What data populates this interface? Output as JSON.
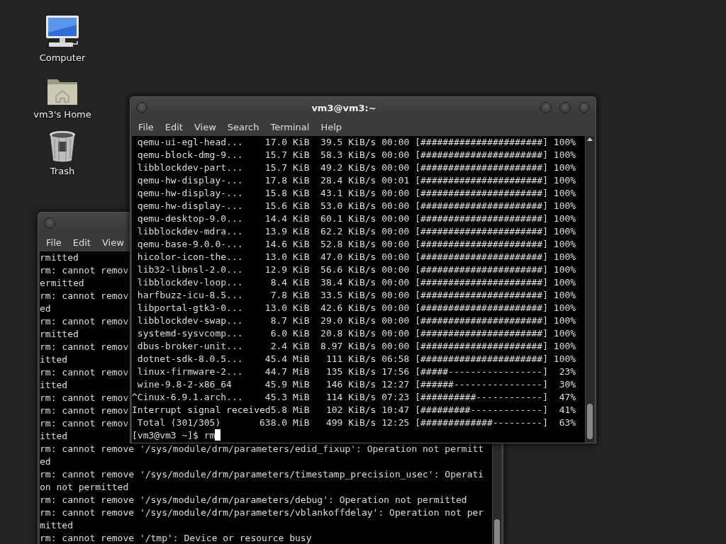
{
  "desktop_icons": [
    {
      "label": "Computer",
      "kind": "computer"
    },
    {
      "label": "vm3's Home",
      "kind": "home"
    },
    {
      "label": "Trash",
      "kind": "trash"
    }
  ],
  "windows": [
    {
      "kind": "back",
      "menu": [
        "File",
        "Edit",
        "View"
      ],
      "lines": [
        "rmitted",
        "rm: cannot remov",
        "ermitted",
        "rm: cannot remov",
        "ed",
        "rm: cannot remov",
        "rmitted",
        "rm: cannot remov",
        "itted",
        "rm: cannot remov",
        "itted",
        "rm: cannot remov",
        "rm: cannot remov",
        "rm: cannot remov",
        "itted",
        "rm: cannot remove '/sys/module/drm/parameters/edid_fixup': Operation not permitt",
        "ed",
        "rm: cannot remove '/sys/module/drm/parameters/timestamp_precision_usec': Operati",
        "on not permitted",
        "rm: cannot remove '/sys/module/drm/parameters/debug': Operation not permitted",
        "rm: cannot remove '/sys/module/drm/parameters/vblankoffdelay': Operation not per",
        "mitted",
        "rm: cannot remove '/tmp': Device or resource busy"
      ]
    },
    {
      "kind": "front",
      "title": "vm3@vm3:~",
      "menu": [
        "File",
        "Edit",
        "View",
        "Search",
        "Terminal",
        "Help"
      ],
      "lines": [
        " qemu-ui-egl-head...    17.0 KiB  39.5 KiB/s 00:00 [######################] 100%",
        " qemu-block-dmg-9...    15.7 KiB  58.3 KiB/s 00:00 [######################] 100%",
        " libblockdev-part...    15.7 KiB  49.2 KiB/s 00:00 [######################] 100%",
        " qemu-hw-display-...    17.8 KiB  28.4 KiB/s 00:01 [######################] 100%",
        " qemu-hw-display-...    15.8 KiB  43.1 KiB/s 00:00 [######################] 100%",
        " qemu-hw-display-...    15.6 KiB  53.0 KiB/s 00:00 [######################] 100%",
        " qemu-desktop-9.0...    14.4 KiB  60.1 KiB/s 00:00 [######################] 100%",
        " libblockdev-mdra...    13.9 KiB  62.2 KiB/s 00:00 [######################] 100%",
        " qemu-base-9.0.0-...    14.6 KiB  52.8 KiB/s 00:00 [######################] 100%",
        " hicolor-icon-the...    13.0 KiB  47.0 KiB/s 00:00 [######################] 100%",
        " lib32-libnsl-2.0...    12.9 KiB  56.6 KiB/s 00:00 [######################] 100%",
        " libblockdev-loop...     8.4 KiB  38.4 KiB/s 00:00 [######################] 100%",
        " harfbuzz-icu-8.5...     7.8 KiB  33.5 KiB/s 00:00 [######################] 100%",
        " libportal-gtk3-0...    13.0 KiB  42.6 KiB/s 00:00 [######################] 100%",
        " libblockdev-swap...     8.7 KiB  29.0 KiB/s 00:00 [######################] 100%",
        " systemd-sysvcomp...     6.0 KiB  20.8 KiB/s 00:00 [######################] 100%",
        " dbus-broker-unit...     2.4 KiB  8.97 KiB/s 00:00 [######################] 100%",
        " dotnet-sdk-8.0.5...    45.4 MiB   111 KiB/s 06:58 [######################] 100%",
        " linux-firmware-2...    44.7 MiB   135 KiB/s 17:56 [#####-----------------]  23%",
        " wine-9.8-2-x86_64      45.9 MiB   146 KiB/s 12:27 [######----------------]  30%",
        "^Cinux-6.9.1.arch...    45.3 MiB   114 KiB/s 07:23 [##########------------]  47%",
        "Interrupt signal received5.8 MiB   102 KiB/s 10:47 [#########-------------]  41%",
        " Total (301/305)       638.0 MiB   499 KiB/s 12:25 [#############---------]  63%"
      ],
      "prompt": "[vm3@vm3 ~]$ rm"
    }
  ]
}
